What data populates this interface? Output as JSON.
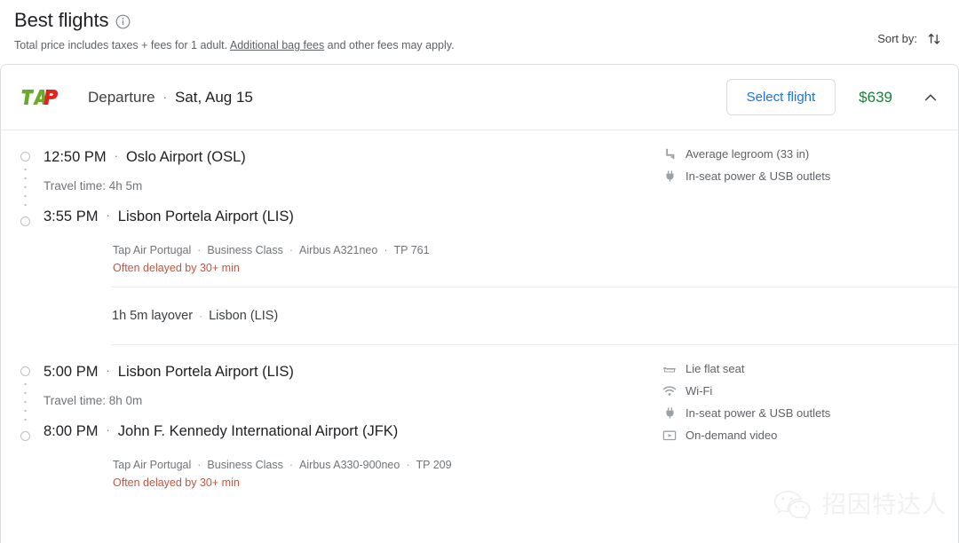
{
  "header": {
    "title": "Best flights",
    "info_icon": "info-icon",
    "subtitle_before": "Total price includes taxes + fees for 1 adult. ",
    "subtitle_link": "Additional bag fees",
    "subtitle_after": " and other fees may apply.",
    "sort_label": "Sort by:",
    "sort_icon": "sort-arrows-icon"
  },
  "card": {
    "airline_logo": "tap-air-portugal-logo",
    "direction_label": "Departure",
    "separator": "·",
    "date": "Sat, Aug 15",
    "select_button": "Select flight",
    "price": "$639",
    "collapse_icon": "chevron-up-icon"
  },
  "legs": [
    {
      "depart_time": "12:50 PM",
      "depart_airport": "Oslo Airport (OSL)",
      "travel_time": "Travel time: 4h 5m",
      "arrive_time": "3:55 PM",
      "arrive_airport": "Lisbon Portela Airport (LIS)",
      "operator": "Tap Air Portugal",
      "cabin": "Business Class",
      "aircraft": "Airbus A321neo",
      "flight_number": "TP 761",
      "delay_warning": "Often delayed by 30+ min",
      "amenities": [
        {
          "icon": "legroom-icon",
          "label": "Average legroom (33 in)"
        },
        {
          "icon": "power-plug-icon",
          "label": "In-seat power & USB outlets"
        }
      ]
    },
    {
      "depart_time": "5:00 PM",
      "depart_airport": "Lisbon Portela Airport (LIS)",
      "travel_time": "Travel time: 8h 0m",
      "arrive_time": "8:00 PM",
      "arrive_airport": "John F. Kennedy International Airport (JFK)",
      "operator": "Tap Air Portugal",
      "cabin": "Business Class",
      "aircraft": "Airbus A330-900neo",
      "flight_number": "TP 209",
      "delay_warning": "Often delayed by 30+ min",
      "amenities": [
        {
          "icon": "lie-flat-seat-icon",
          "label": "Lie flat seat"
        },
        {
          "icon": "wifi-icon",
          "label": "Wi-Fi"
        },
        {
          "icon": "power-plug-icon",
          "label": "In-seat power & USB outlets"
        },
        {
          "icon": "video-icon",
          "label": "On-demand video"
        }
      ]
    }
  ],
  "layover": {
    "duration": "1h 5m layover",
    "separator": "·",
    "airport": "Lisbon (LIS)"
  },
  "watermark": {
    "icon": "wechat-logo",
    "text": "招因特达人"
  },
  "colors": {
    "link_blue": "#1a73e8",
    "price_green": "#188038",
    "delay_red": "#c5543f",
    "logo_green": "#6aaa2c",
    "logo_red": "#e2231a"
  }
}
